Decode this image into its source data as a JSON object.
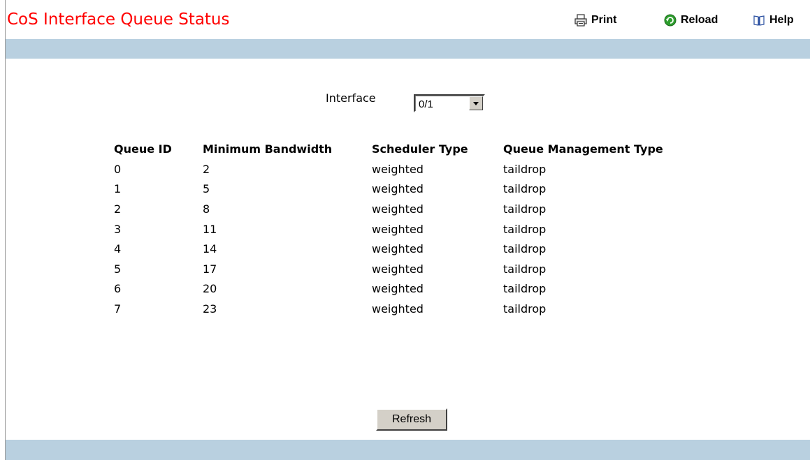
{
  "header": {
    "title": "CoS Interface Queue Status",
    "title_color": "#ff0000",
    "toolbar": [
      {
        "label": "Print",
        "icon": "printer-icon"
      },
      {
        "label": "Reload",
        "icon": "reload-icon"
      },
      {
        "label": "Help",
        "icon": "help-book-icon"
      }
    ]
  },
  "band_color": "#b9d0e0",
  "interface": {
    "label": "Interface",
    "selected": "0/1"
  },
  "table": {
    "headers": [
      "Queue ID",
      "Minimum Bandwidth",
      "Scheduler Type",
      "Queue Management Type"
    ],
    "rows": [
      [
        "0",
        "2",
        "weighted",
        "taildrop"
      ],
      [
        "1",
        "5",
        "weighted",
        "taildrop"
      ],
      [
        "2",
        "8",
        "weighted",
        "taildrop"
      ],
      [
        "3",
        "11",
        "weighted",
        "taildrop"
      ],
      [
        "4",
        "14",
        "weighted",
        "taildrop"
      ],
      [
        "5",
        "17",
        "weighted",
        "taildrop"
      ],
      [
        "6",
        "20",
        "weighted",
        "taildrop"
      ],
      [
        "7",
        "23",
        "weighted",
        "taildrop"
      ]
    ]
  },
  "refresh_label": "Refresh"
}
